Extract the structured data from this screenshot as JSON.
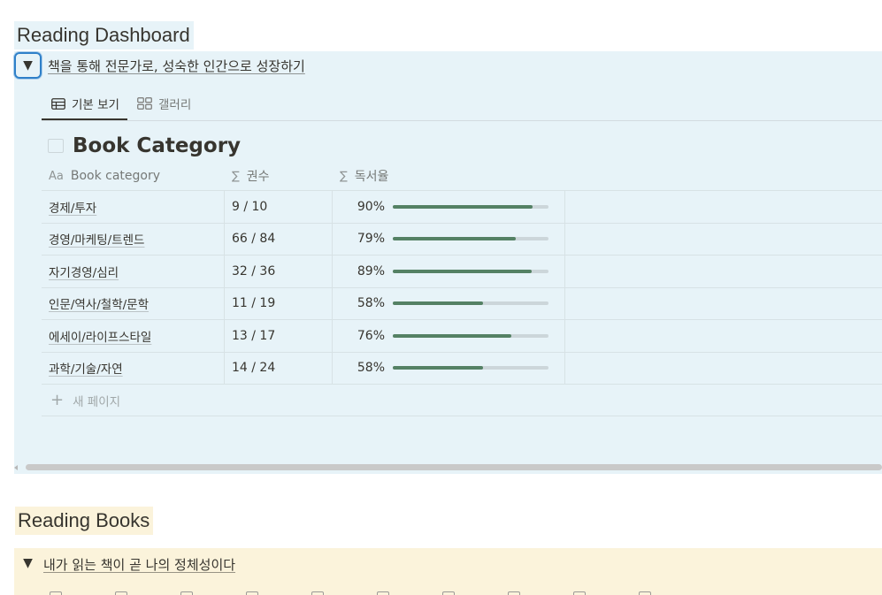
{
  "dashboard": {
    "heading": "Reading Dashboard",
    "toggle_title": "책을 통해 전문가로, 성숙한 인간으로 성장하기",
    "tabs": [
      {
        "label": "기본 보기",
        "icon": "table-icon",
        "active": true
      },
      {
        "label": "갤러리",
        "icon": "gallery-icon",
        "active": false
      }
    ],
    "database_title": "Book Category",
    "columns": [
      {
        "label": "Book category",
        "icon": "Aa"
      },
      {
        "label": "권수",
        "icon": "∑"
      },
      {
        "label": "독서율",
        "icon": "∑"
      }
    ],
    "rows": [
      {
        "category": "경제/투자",
        "count": "9 / 10",
        "rate_label": "90%",
        "rate": 0.9
      },
      {
        "category": "경영/마케팅/트렌드",
        "count": "66 / 84",
        "rate_label": "79%",
        "rate": 0.79
      },
      {
        "category": "자기경영/심리",
        "count": "32 / 36",
        "rate_label": "89%",
        "rate": 0.89
      },
      {
        "category": "인문/역사/철학/문학",
        "count": "11 / 19",
        "rate_label": "58%",
        "rate": 0.58
      },
      {
        "category": "에세이/라이프스타일",
        "count": "13 / 17",
        "rate_label": "76%",
        "rate": 0.76
      },
      {
        "category": "과학/기술/자연",
        "count": "14 / 24",
        "rate_label": "58%",
        "rate": 0.58
      }
    ],
    "new_page_label": "새 페이지",
    "colors": {
      "block_bg": "#e7f3f8",
      "progress": "#548164",
      "focus": "#2f80c9"
    }
  },
  "books": {
    "heading": "Reading Books",
    "toggle_title": "내가 읽는 책이 곧 나의 정체성이다",
    "colors": {
      "block_bg": "#fbf3db"
    }
  }
}
